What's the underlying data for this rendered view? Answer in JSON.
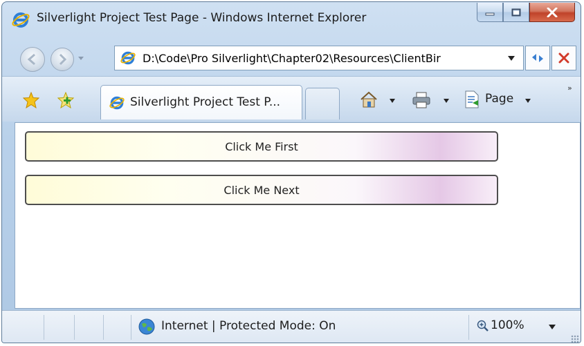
{
  "window": {
    "title": "Silverlight Project Test Page - Windows Internet Explorer"
  },
  "address_bar": {
    "url": "D:\\Code\\Pro Silverlight\\Chapter02\\Resources\\ClientBir"
  },
  "tabs": [
    {
      "label": "Silverlight Project Test P..."
    }
  ],
  "command_bar": {
    "page_label": "Page",
    "overflow": "»"
  },
  "content": {
    "buttons": [
      {
        "label": "Click Me First"
      },
      {
        "label": "Click Me Next"
      }
    ]
  },
  "status_bar": {
    "zone_text": "Internet | Protected Mode: On",
    "zoom": "100%"
  },
  "icons": [
    "ie-icon",
    "minimize-icon",
    "maximize-icon",
    "close-icon",
    "back-icon",
    "forward-icon",
    "refresh-icon",
    "stop-icon",
    "favorites-star-icon",
    "add-favorites-icon",
    "home-icon",
    "print-icon",
    "page-icon",
    "globe-icon",
    "zoom-icon"
  ],
  "colors": {
    "frame": "#b9d1ea",
    "close_button": "#c0432a",
    "button_border": "#4d4d4d"
  }
}
